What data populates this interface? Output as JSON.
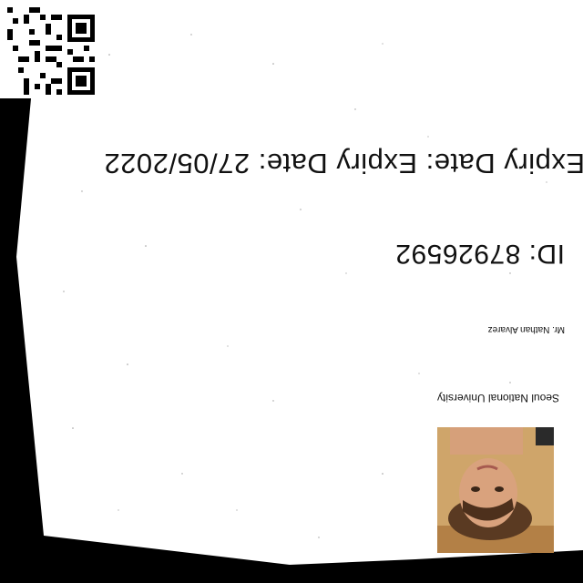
{
  "card": {
    "university": "Seoul National University",
    "holder_name": "Mr. Nathan Alvarez",
    "id_text": "ID: 87926592",
    "expiry_text": "Expiry Date: Expiry Date: 27/05/2022"
  },
  "colors": {
    "background": "#000000",
    "card": "#ffffff",
    "text": "#111111"
  }
}
